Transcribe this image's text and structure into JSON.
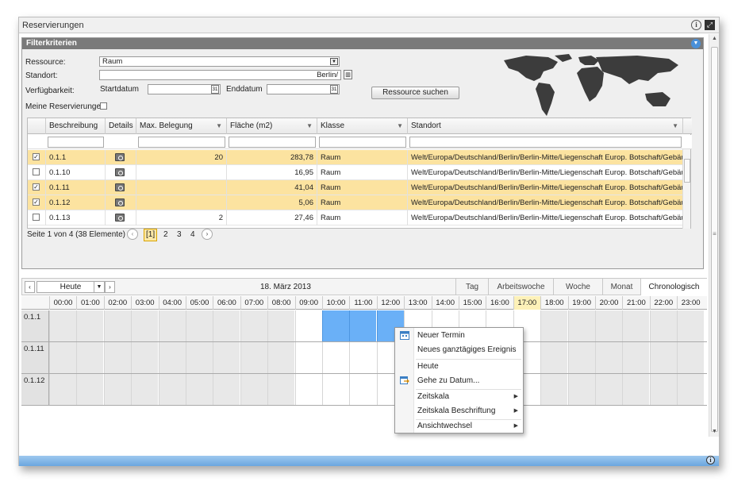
{
  "window": {
    "title": "Reservierungen"
  },
  "filter": {
    "header": "Filterkriterien",
    "ressource_label": "Ressource:",
    "ressource_value": "Raum",
    "standort_label": "Standort:",
    "standort_value": "Berlin/",
    "verfuegbarkeit_label": "Verfügbarkeit:",
    "startdatum_label": "Startdatum",
    "enddatum_label": "Enddatum",
    "cal_glyph": "31",
    "find_button": "Ressource suchen",
    "meine_label": "Meine Reservierungen"
  },
  "grid": {
    "columns": [
      "Beschreibung",
      "Details",
      "Max. Belegung",
      "Fläche (m2)",
      "Klasse",
      "Standort"
    ],
    "rows": [
      {
        "name": "0.1.1",
        "belegung": "20",
        "flaeche": "283,78",
        "klasse": "Raum",
        "standort": "Welt/Europa/Deutschland/Berlin/Berlin-Mitte/Liegenschaft Europ. Botschaft/Gebäude Europ. Bots",
        "checked": true
      },
      {
        "name": "0.1.10",
        "belegung": "",
        "flaeche": "16,95",
        "klasse": "Raum",
        "standort": "Welt/Europa/Deutschland/Berlin/Berlin-Mitte/Liegenschaft Europ. Botschaft/Gebäude Europ. Bots",
        "checked": false
      },
      {
        "name": "0.1.11",
        "belegung": "",
        "flaeche": "41,04",
        "klasse": "Raum",
        "standort": "Welt/Europa/Deutschland/Berlin/Berlin-Mitte/Liegenschaft Europ. Botschaft/Gebäude Europ. Bots",
        "checked": true
      },
      {
        "name": "0.1.12",
        "belegung": "",
        "flaeche": "5,06",
        "klasse": "Raum",
        "standort": "Welt/Europa/Deutschland/Berlin/Berlin-Mitte/Liegenschaft Europ. Botschaft/Gebäude Europ. Bots",
        "checked": true
      },
      {
        "name": "0.1.13",
        "belegung": "2",
        "flaeche": "27,46",
        "klasse": "Raum",
        "standort": "Welt/Europa/Deutschland/Berlin/Berlin-Mitte/Liegenschaft Europ. Botschaft/Gebäude Europ. Bots",
        "checked": false
      }
    ]
  },
  "pager": {
    "summary": "Seite 1 von 4 (38 Elemente)",
    "current": "[1]",
    "pages": [
      "2",
      "3",
      "4"
    ]
  },
  "calendar": {
    "today_label": "Heute",
    "date_title": "18. März 2013",
    "views": [
      "Tag",
      "Arbeitswoche",
      "Woche",
      "Monat",
      "Chronologisch"
    ],
    "active_view": "Chronologisch",
    "hours": [
      "00:00",
      "01:00",
      "02:00",
      "03:00",
      "04:00",
      "05:00",
      "06:00",
      "07:00",
      "08:00",
      "09:00",
      "10:00",
      "11:00",
      "12:00",
      "13:00",
      "14:00",
      "15:00",
      "16:00",
      "17:00",
      "18:00",
      "19:00",
      "20:00",
      "21:00",
      "22:00",
      "23:00"
    ],
    "current_hour": "17:00",
    "resources": [
      "0.1.1",
      "0.1.11",
      "0.1.12"
    ]
  },
  "context_menu": {
    "items": [
      {
        "label": "Neuer Termin",
        "icon": "calendar-icon"
      },
      {
        "label": "Neues ganztägiges Ereignis",
        "icon": ""
      },
      {
        "label": "Heute",
        "icon": ""
      },
      {
        "label": "Gehe zu Datum...",
        "icon": "goto-date-icon"
      },
      {
        "label": "Zeitskala",
        "submenu": true
      },
      {
        "label": "Zeitskala Beschriftung",
        "submenu": true
      },
      {
        "label": "Ansichtwechsel",
        "submenu": true
      }
    ]
  },
  "colors": {
    "selected_row": "#fce3a0",
    "selection_blue": "#6ab0f7",
    "header_gray": "#7a7a7a",
    "statusbar_blue": "#6aa6df"
  }
}
